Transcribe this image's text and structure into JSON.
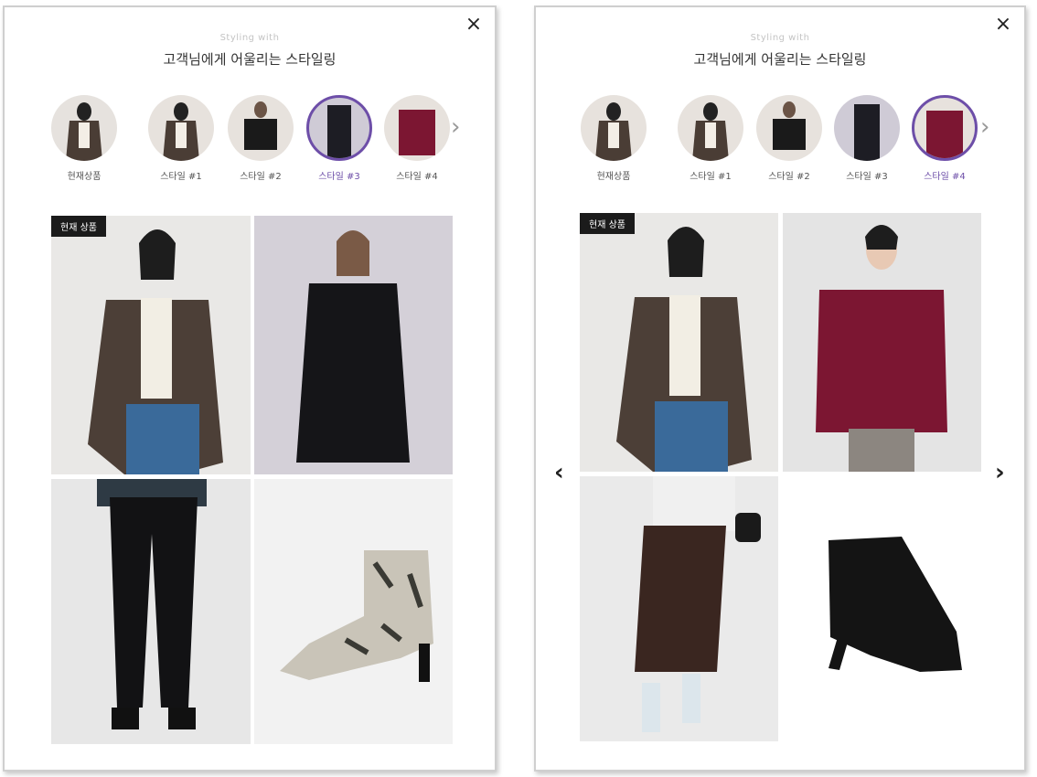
{
  "panels": [
    {
      "subtitle": "Styling with",
      "title": "고객님에게 어울리는 스타일링",
      "close_icon": "×",
      "thumbs": [
        "현재상품",
        "스타일 #1",
        "스타일 #2",
        "스타일 #3",
        "스타일 #4"
      ],
      "active_thumb": 3,
      "badge": "현재 상품"
    },
    {
      "subtitle": "Styling with",
      "title": "고객님에게 어울리는 스타일링",
      "close_icon": "×",
      "thumbs": [
        "현재상품",
        "스타일 #1",
        "스타일 #2",
        "스타일 #3",
        "스타일 #4"
      ],
      "active_thumb": 4,
      "badge": "현재 상품"
    }
  ],
  "icons": {
    "next": "›",
    "prev": "‹"
  },
  "colors": {
    "accent": "#6d4ea8",
    "badge_bg": "#1b1b1b"
  }
}
